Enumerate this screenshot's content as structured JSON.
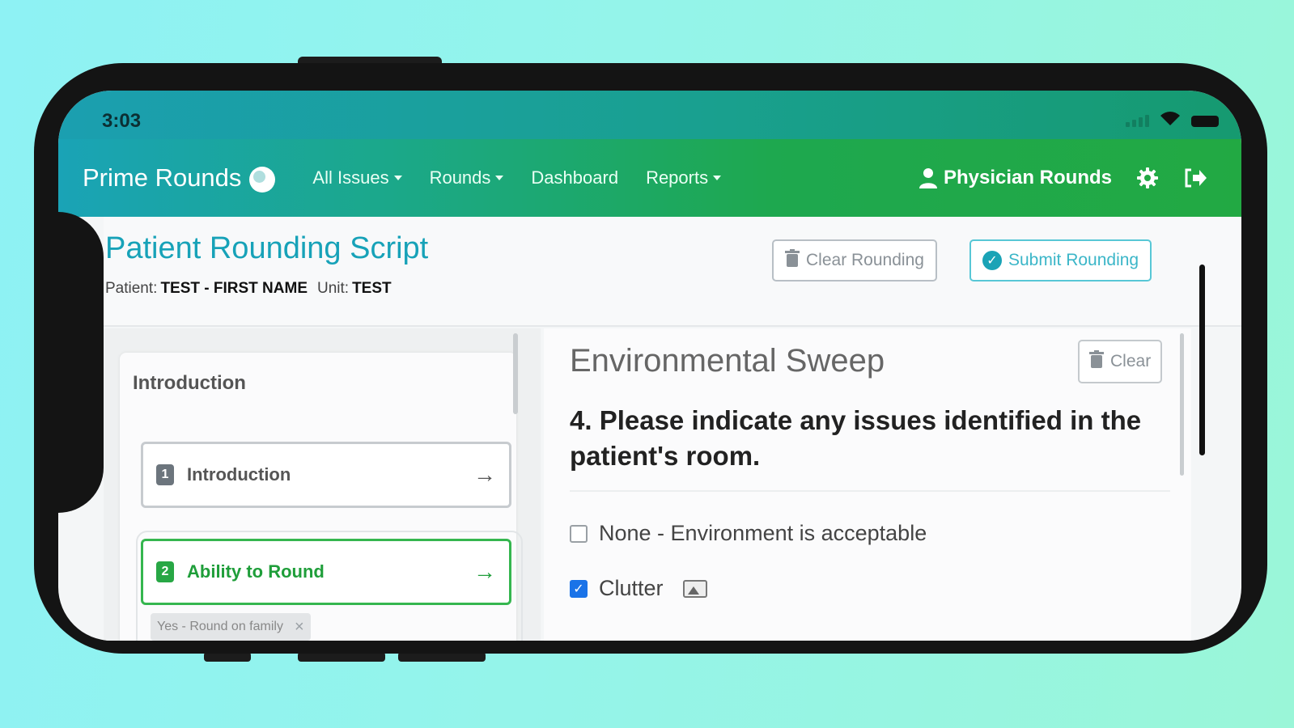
{
  "status_bar": {
    "time": "3:03"
  },
  "navbar": {
    "brand": "Prime Rounds",
    "links": [
      {
        "label": "All Issues",
        "dropdown": true
      },
      {
        "label": "Rounds",
        "dropdown": true
      },
      {
        "label": "Dashboard",
        "dropdown": false
      },
      {
        "label": "Reports",
        "dropdown": true
      }
    ],
    "user_label": "Physician Rounds"
  },
  "header": {
    "title": "Patient Rounding Script",
    "patient_label": "Patient:",
    "patient_value": "TEST - FIRST NAME",
    "unit_label": "Unit:",
    "unit_value": "TEST",
    "clear_rounding_label": "Clear Rounding",
    "submit_rounding_label": "Submit Rounding"
  },
  "sidebar": {
    "section_label": "Introduction",
    "steps": [
      {
        "number": "1",
        "label": "Introduction"
      },
      {
        "number": "2",
        "label": "Ability to Round"
      }
    ],
    "tag": "Yes - Round on family"
  },
  "main": {
    "section_title": "Environmental Sweep",
    "clear_label": "Clear",
    "question": "4. Please indicate any issues identified in the patient's room.",
    "options": [
      {
        "label": "None - Environment is acceptable",
        "checked": false
      },
      {
        "label": "Clutter",
        "checked": true
      }
    ]
  },
  "colors": {
    "title": "#17a2b8",
    "active_step": "#28a745",
    "nav_green": "#22a943",
    "nav_teal": "#1aa3b6"
  }
}
